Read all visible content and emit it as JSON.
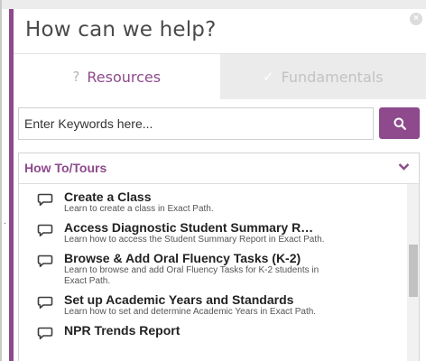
{
  "panel": {
    "title": "How can we help?",
    "close_symbol": "×",
    "accent_color": "#8e4a8c"
  },
  "tabs": [
    {
      "label": "Resources",
      "icon": "question-icon",
      "icon_glyph": "?",
      "active": true
    },
    {
      "label": "Fundamentals",
      "icon": "checkmark-icon",
      "icon_glyph": "✓",
      "active": false
    }
  ],
  "search": {
    "placeholder": "Enter Keywords here...",
    "button_icon": "search-icon"
  },
  "list": {
    "title": "How To/Tours",
    "toggle_icon": "chevron-down-icon",
    "item_icon": "speech-bubble-icon",
    "items": [
      {
        "title": "Create a Class",
        "desc": "Learn to create a class in Exact Path."
      },
      {
        "title": "Access Diagnostic Student Summary R…",
        "desc": "Learn how to access the Student Summary Report in Exact Path."
      },
      {
        "title": "Browse & Add Oral Fluency Tasks (K-2)",
        "desc": "Learn to browse and add Oral Fluency Tasks for K-2 students in Exact Path."
      },
      {
        "title": "Set up Academic Years and Standards",
        "desc": "Learn how to set and determine Academic Years in Exact Path."
      },
      {
        "title": "NPR Trends Report",
        "desc": ""
      }
    ]
  },
  "stage": {
    "tick": "."
  }
}
